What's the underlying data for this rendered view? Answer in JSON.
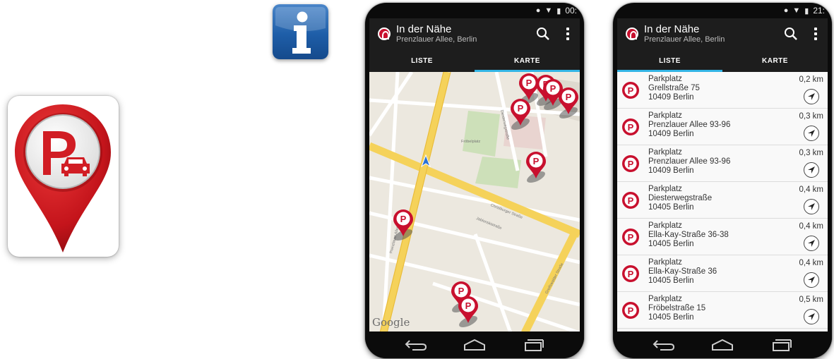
{
  "colors": {
    "brand_red": "#c8102e",
    "action_bar": "#1d1d1d",
    "tab_indicator": "#33b5e5",
    "info_blue": "#1e5ea8"
  },
  "icons": {
    "app_icon": "parking-pin-icon",
    "info_icon": "info-icon",
    "search": "search-icon",
    "overflow": "overflow-menu-icon",
    "navigate": "navigate-arrow-icon",
    "back": "back-icon",
    "home": "home-icon",
    "recents": "recents-icon"
  },
  "phone_map": {
    "status": {
      "time": "00:"
    },
    "action_bar": {
      "title": "In der Nähe",
      "subtitle": "Prenzlauer Allee, Berlin"
    },
    "tabs": [
      {
        "label": "LISTE",
        "active": false
      },
      {
        "label": "KARTE",
        "active": true
      }
    ],
    "map": {
      "provider_logo": "Google",
      "street_labels": [
        "Fröbelplatz",
        "Christburger Straße",
        "Jablonskistraße",
        "Prenzlauer Allee",
        "Greifswalder Straße",
        "Diesterwegstraße"
      ]
    }
  },
  "phone_list": {
    "status": {
      "time": "21:"
    },
    "action_bar": {
      "title": "In der Nähe",
      "subtitle": "Prenzlauer Allee, Berlin"
    },
    "tabs": [
      {
        "label": "LISTE",
        "active": true
      },
      {
        "label": "KARTE",
        "active": false
      }
    ],
    "items": [
      {
        "type": "Parkplatz",
        "street": "Grellstraße 75",
        "city": "10409 Berlin",
        "distance": "0,2 km"
      },
      {
        "type": "Parkplatz",
        "street": "Prenzlauer Allee 93-96",
        "city": "10409 Berlin",
        "distance": "0,3 km"
      },
      {
        "type": "Parkplatz",
        "street": "Prenzlauer Allee 93-96",
        "city": "10409 Berlin",
        "distance": "0,3 km"
      },
      {
        "type": "Parkplatz",
        "street": "Diesterwegstraße",
        "city": "10405 Berlin",
        "distance": "0,4 km"
      },
      {
        "type": "Parkplatz",
        "street": "Ella-Kay-Straße 36-38",
        "city": "10405 Berlin",
        "distance": "0,4 km"
      },
      {
        "type": "Parkplatz",
        "street": "Ella-Kay-Straße 36",
        "city": "10405 Berlin",
        "distance": "0,4 km"
      },
      {
        "type": "Parkplatz",
        "street": "Fröbelstraße 15",
        "city": "10405 Berlin",
        "distance": "0,5 km"
      }
    ]
  }
}
